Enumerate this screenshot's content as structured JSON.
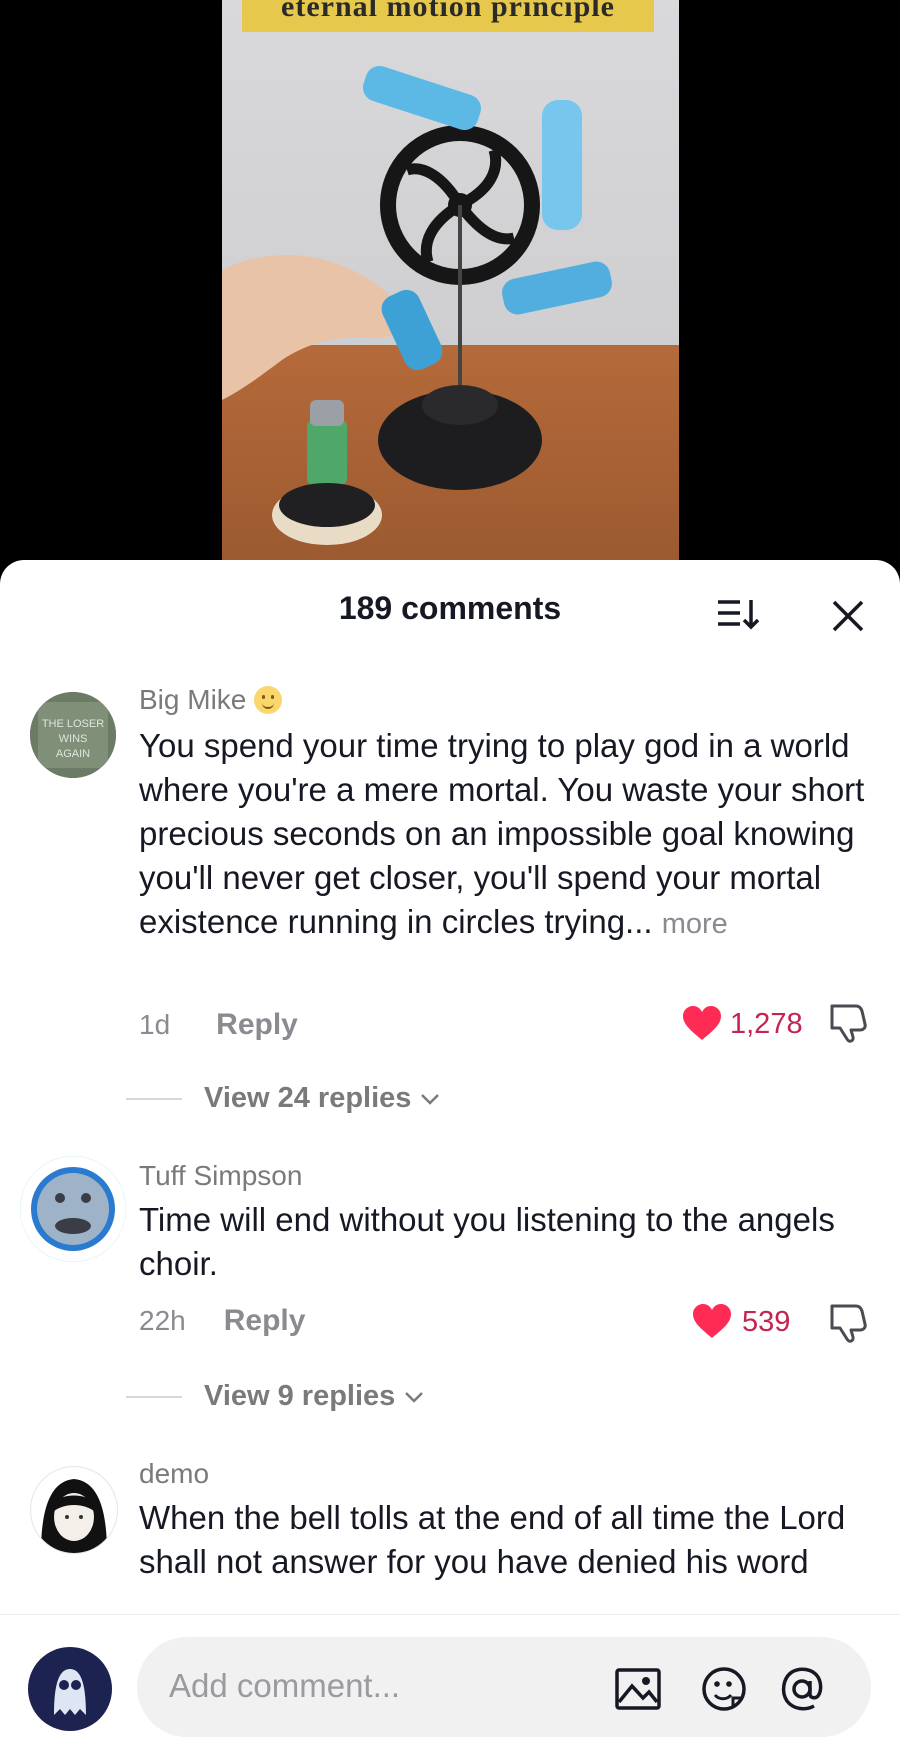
{
  "video": {
    "overlay_text": "eternal motion principle"
  },
  "header": {
    "title": "189 comments"
  },
  "comments": [
    {
      "username": "Big Mike",
      "text": "You spend your time trying to play god in a world where you're a mere mortal. You waste your short precious seconds on an impossible goal knowing you'll never get closer, you'll spend your mortal existence running in circles trying...",
      "more_label": "more",
      "time": "1d",
      "reply_label": "Reply",
      "likes": "1,278",
      "view_replies": "View 24 replies",
      "avatar_text": "THE LOSER WINS AGAIN"
    },
    {
      "username": "Tuff Simpson",
      "text": "Time will end without you listening to the angels choir.",
      "time": "22h",
      "reply_label": "Reply",
      "likes": "539",
      "view_replies": "View 9 replies"
    },
    {
      "username": "demo",
      "text": "When the bell tolls at the end of all time the Lord shall not answer for you have denied his word"
    }
  ],
  "composer": {
    "placeholder": "Add comment..."
  },
  "colors": {
    "like": "#fe2c55",
    "text": "#161823",
    "muted": "#8a8b91"
  }
}
